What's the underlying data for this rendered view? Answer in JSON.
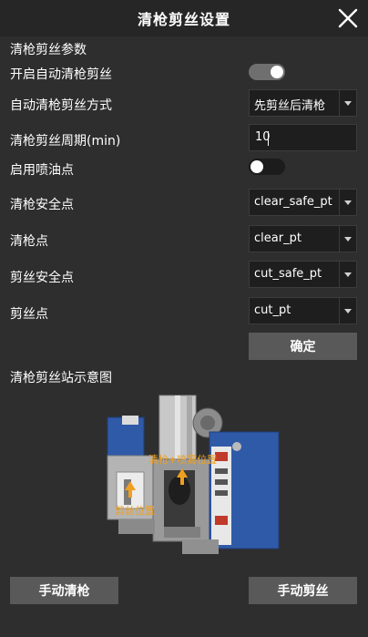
{
  "window": {
    "title": "清枪剪丝设置",
    "close_icon": "close-icon"
  },
  "params": {
    "section_title": "清枪剪丝参数",
    "auto_clean_cut": {
      "label": "开启自动清枪剪丝",
      "enabled": true
    },
    "auto_mode": {
      "label": "自动清枪剪丝方式",
      "selected": "先剪丝后清枪"
    },
    "cycle": {
      "label": "清枪剪丝周期(min)",
      "value": "10"
    },
    "oil_spray": {
      "label": "启用喷油点",
      "enabled": false
    },
    "clean_safe_point": {
      "label": "清枪安全点",
      "selected": "clear_safe_pt"
    },
    "clean_point": {
      "label": "清枪点",
      "selected": "clear_pt"
    },
    "cut_safe_point": {
      "label": "剪丝安全点",
      "selected": "cut_safe_pt"
    },
    "cut_point": {
      "label": "剪丝点",
      "selected": "cut_pt"
    },
    "confirm_label": "确定"
  },
  "diagram": {
    "section_title": "清枪剪丝站示意图",
    "callout_clean": "清枪+喷雾位置",
    "callout_cut": "剪丝位置"
  },
  "actions": {
    "manual_clean": "手动清枪",
    "manual_cut": "手动剪丝"
  },
  "colors": {
    "background": "#2e2e2e",
    "field": "#1e1e1e",
    "button": "#595959",
    "callout": "#f0a020",
    "station_blue": "#2f5aa8"
  }
}
